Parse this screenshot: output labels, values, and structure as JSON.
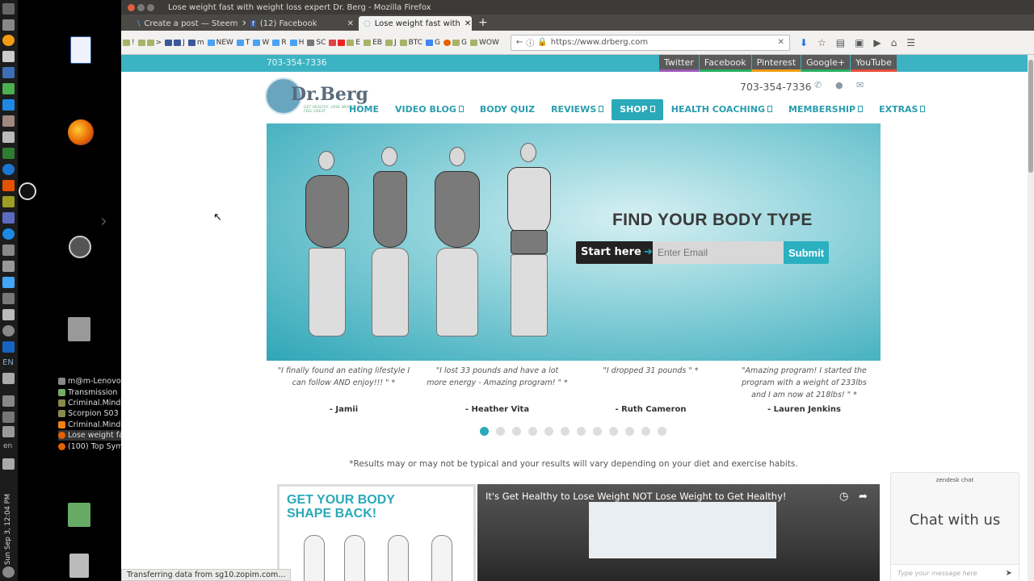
{
  "window": {
    "title": "Lose weight fast with weight loss expert Dr. Berg - Mozilla Firefox"
  },
  "tabs": [
    {
      "label": "Create a post — Steem"
    },
    {
      "label": "(12) Facebook"
    },
    {
      "label": "Lose weight fast with"
    }
  ],
  "bookmarks": [
    "!",
    ">",
    "J",
    "m",
    "NEW",
    "T",
    "W",
    "R",
    "H",
    "SC",
    "E",
    "EB",
    "J",
    "BTC",
    "G",
    "G",
    "WOW"
  ],
  "url": "https://www.drberg.com",
  "dock": {
    "lang": "EN",
    "lang2": "en",
    "clock": "Sun Sep 3, 12:04 PM"
  },
  "taskbar": [
    {
      "label": "m@m-Lenovo-..."
    },
    {
      "label": "Transmission"
    },
    {
      "label": "Criminal.Minds..."
    },
    {
      "label": "Scorpion S03 S..."
    },
    {
      "label": "Criminal.Minds..."
    },
    {
      "label": "Lose weight fa..."
    },
    {
      "label": "(100) Top Symp..."
    }
  ],
  "site": {
    "top_phone": "703-354-7336",
    "social": [
      {
        "label": "Twitter",
        "color": "#9b59b6"
      },
      {
        "label": "Facebook",
        "color": "#27ae60"
      },
      {
        "label": "Pinterest",
        "color": "#f39c12"
      },
      {
        "label": "Google+",
        "color": "#27ae60"
      },
      {
        "label": "YouTube",
        "color": "#e74c3c"
      }
    ],
    "logo": {
      "name": "Dr.Berg",
      "tagline": "GET HEALTHY, LOSE WEIGHT & FEEL GREAT"
    },
    "header_phone": "703-354-7336",
    "nav": [
      {
        "label": "HOME",
        "dropdown": false
      },
      {
        "label": "VIDEO BLOG",
        "dropdown": true
      },
      {
        "label": "BODY QUIZ",
        "dropdown": false
      },
      {
        "label": "REVIEWS",
        "dropdown": true
      },
      {
        "label": "SHOP",
        "dropdown": true
      },
      {
        "label": "HEALTH COACHING",
        "dropdown": true
      },
      {
        "label": "MEMBERSHIP",
        "dropdown": true
      },
      {
        "label": "EXTRAS",
        "dropdown": true
      }
    ],
    "hero": {
      "title": "FIND YOUR BODY TYPE",
      "start": "Start here",
      "email_placeholder": "Enter Email",
      "submit": "Submit"
    },
    "testimonials": [
      {
        "quote": "\"I finally found an eating lifestyle I can follow AND enjoy!!! \" *",
        "name": "- Jamii"
      },
      {
        "quote": "\"I lost 33 pounds and have a lot more energy - Amazing program! \" *",
        "name": "- Heather Vita"
      },
      {
        "quote": "\"I dropped 31 pounds \" *",
        "name": "- Ruth Cameron"
      },
      {
        "quote": "\"Amazing program! I started the program with a weight of 233lbs and I am now at 218lbs! \" *",
        "name": "- Lauren Jenkins"
      }
    ],
    "carousel": {
      "count": 12,
      "active": 1
    },
    "disclaimer": "*Results may or may not be typical and your results will vary depending on your diet and exercise habits.",
    "shape_card": {
      "title": "GET YOUR BODY SHAPE BACK!"
    },
    "video": {
      "title": "It's Get Healthy to Lose Weight NOT Lose Weight to Get Healthy!"
    },
    "chat": {
      "brand": "zendesk chat",
      "title": "Chat with us",
      "placeholder": "Type your message here"
    }
  },
  "status": "Transferring data from sg10.zopim.com..."
}
